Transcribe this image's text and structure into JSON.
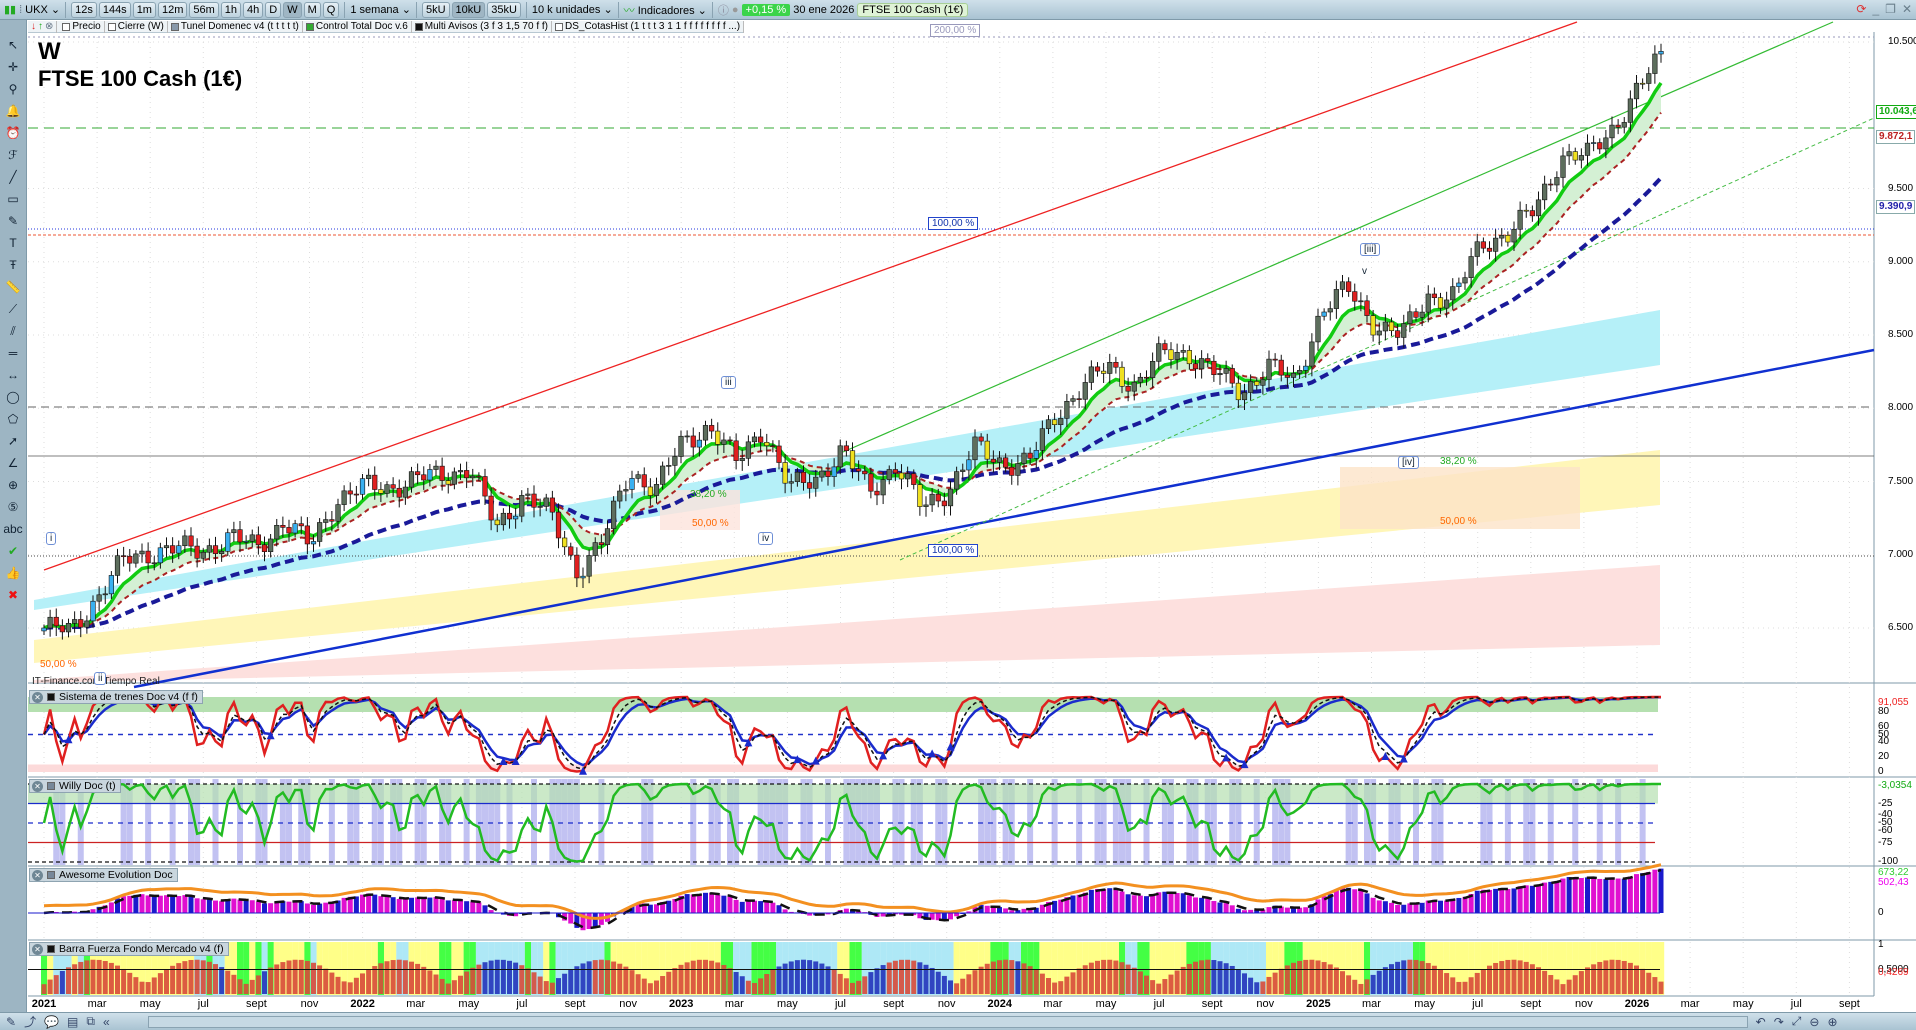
{
  "toolbar": {
    "symbol": "UKX",
    "periods": [
      "12s",
      "144s",
      "1m",
      "12m",
      "56m",
      "1h",
      "4h",
      "D",
      "W",
      "M",
      "Q"
    ],
    "active_period": "W",
    "period_select": "1 semana",
    "units": [
      "5kU",
      "10kU",
      "35kU"
    ],
    "active_unit": "10kU",
    "units_select": "10 k unidades",
    "indicators": "Indicadores",
    "change": "+0,15 %",
    "date": "30 ene 2026",
    "instrument": "FTSE 100 Cash (1€)"
  },
  "overlays": [
    {
      "label": "Precio",
      "color": "#ffffff"
    },
    {
      "label": "Cierre (W)",
      "color": "#ffffff"
    },
    {
      "label": "Tunel Domenec v4 (t t t t t)",
      "color": "#8899aa"
    },
    {
      "label": "Control Total Doc v.6",
      "color": "#33aa33"
    },
    {
      "label": "Multi Avisos (3 f 3 1,5 70 f f)",
      "color": "#111111"
    },
    {
      "label": "DS_CotasHist (1 t t t 3 1 1 f f f f f f f f ...)",
      "color": "#ffffff"
    }
  ],
  "left_tools": [
    "cursor-icon",
    "crosshair-icon",
    "zoom-icon",
    "bell-icon",
    "alarm-icon",
    "fibonacci-icon",
    "line-icon",
    "rectangle-icon",
    "pen-icon",
    "text-icon",
    "text-t-icon",
    "ruler-icon",
    "trendline-icon",
    "channel-icon",
    "parallel-icon",
    "measure-icon",
    "ellipse-icon",
    "polygon-icon",
    "arrow-icon",
    "angle-icon",
    "circle-plus-icon",
    "wave-count-icon",
    "abc-icon",
    "check-icon",
    "thumbs-up-icon",
    "delete-icon"
  ],
  "header": {
    "timeframe": "W",
    "name": "FTSE 100 Cash (1€)"
  },
  "watermark": "IT-Finance.com Tiempo Real",
  "annotations": {
    "pct_200": "200,00 %",
    "pct_100a": "100,00 %",
    "pct_100b": "100,00 %",
    "fib38a": "38,20 %",
    "fib50a": "50,00 %",
    "fib38b": "38,20 %",
    "fib50b": "50,00 %",
    "fib50c": "50,00 %",
    "waves": [
      "i",
      "ii",
      "iii",
      "iv",
      "[iii]",
      "v",
      "[iv]"
    ]
  },
  "panels": [
    {
      "name": "Sistema de trenes Doc v4 (f f)",
      "axis": [
        "91,055",
        "80",
        "60",
        "50",
        "40",
        "20",
        "0"
      ]
    },
    {
      "name": "Willy Doc (t)",
      "axis": [
        "-3,0354",
        "-25",
        "-40",
        "-50",
        "-60",
        "-75",
        "-100"
      ]
    },
    {
      "name": "Awesome Evolution Doc",
      "axis": [
        "673,22",
        "502,43",
        "0"
      ]
    },
    {
      "name": "Barra Fuerza Fondo Mercado v4 (f)",
      "axis": [
        "1",
        "0,5000",
        "0,4269"
      ]
    }
  ],
  "price_tags": {
    "last": "10.043,6",
    "level": "9.872,1",
    "ma": "9.390,9"
  },
  "colors": {
    "up": "#5d6e5d",
    "down": "#e02020",
    "green_ma": "#11cc11",
    "red_ma": "#aa2222",
    "blue_ma": "#1a1a99",
    "trend_blue": "#1030d0"
  },
  "chart_data": {
    "type": "candlestick",
    "title": "FTSE 100 Cash (1€)",
    "timeframe": "weekly",
    "x_start": "2021-01",
    "monthly_close": [
      6500,
      6480,
      6710,
      6960,
      7020,
      7040,
      7030,
      7120,
      7050,
      7230,
      7060,
      7380,
      7460,
      7460,
      7520,
      7540,
      7600,
      7170,
      7420,
      7280,
      6890,
      7090,
      7570,
      7450,
      7770,
      7880,
      7630,
      7870,
      7450,
      7530,
      7700,
      7440,
      7610,
      7320,
      7450,
      7730,
      7630,
      7630,
      7950,
      8150,
      8280,
      8160,
      8370,
      8380,
      8240,
      8110,
      8290,
      8170,
      8670,
      8810,
      8580,
      8490,
      8770,
      8760,
      9130,
      9190,
      9350,
      9720,
      9720,
      9930,
      10200
    ],
    "y_ticks": [
      "10.500",
      "9.500",
      "9.000",
      "8.500",
      "8.000",
      "7.500",
      "7.000",
      "6.500"
    ],
    "y_tick_values": [
      10500,
      9500,
      9000,
      8500,
      8000,
      7500,
      7000,
      6500
    ],
    "ylim": [
      6350,
      10600
    ],
    "x_ticks": [
      "2021",
      "mar",
      "may",
      "jul",
      "sept",
      "nov",
      "2022",
      "mar",
      "may",
      "jul",
      "sept",
      "nov",
      "2023",
      "mar",
      "may",
      "jul",
      "sept",
      "nov",
      "2024",
      "mar",
      "may",
      "jul",
      "sept",
      "nov",
      "2025",
      "mar",
      "may",
      "jul",
      "sept",
      "nov",
      "2026",
      "mar",
      "may",
      "jul",
      "sept"
    ]
  }
}
